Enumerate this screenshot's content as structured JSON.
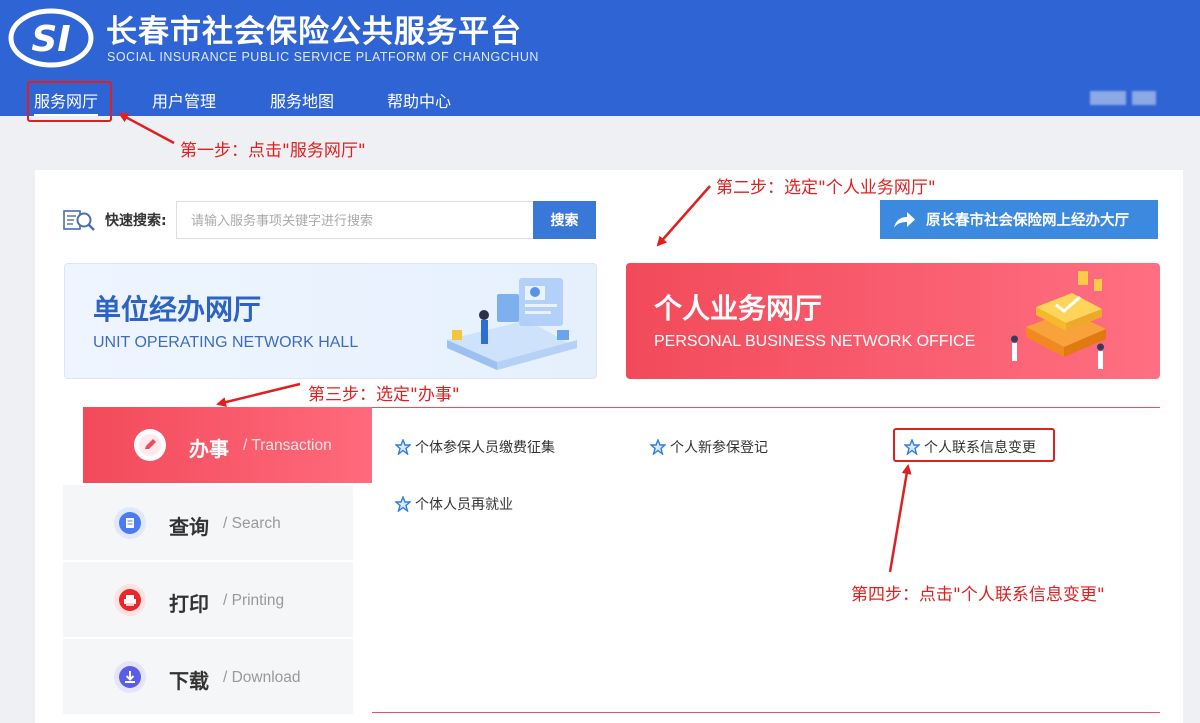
{
  "header": {
    "logo_text": "SI",
    "title": "长春市社会保险公共服务平台",
    "subtitle": "SOCIAL INSURANCE PUBLIC SERVICE PLATFORM OF CHANGCHUN"
  },
  "nav": {
    "items": [
      {
        "label": "服务网厅"
      },
      {
        "label": "用户管理"
      },
      {
        "label": "服务地图"
      },
      {
        "label": "帮助中心"
      }
    ]
  },
  "search": {
    "label": "快速搜索:",
    "placeholder": "请输入服务事项关键字进行搜索",
    "button": "搜索"
  },
  "old_hall_button": "原长春市社会保险网上经办大厅",
  "cards": {
    "unit": {
      "title": "单位经办网厅",
      "subtitle": "UNIT OPERATING NETWORK HALL"
    },
    "personal": {
      "title": "个人业务网厅",
      "subtitle": "PERSONAL BUSINESS NETWORK OFFICE"
    }
  },
  "categories": [
    {
      "label": "办事",
      "en": "/ Transaction"
    },
    {
      "label": "查询",
      "en": "/ Search"
    },
    {
      "label": "打印",
      "en": "/ Printing"
    },
    {
      "label": "下载",
      "en": "/ Download"
    }
  ],
  "services": [
    {
      "label": "个体参保人员缴费征集"
    },
    {
      "label": "个人新参保登记"
    },
    {
      "label": "个人联系信息变更"
    },
    {
      "label": "个体人员再就业"
    }
  ],
  "annotations": {
    "step1": "第一步：点击\"服务网厅\"",
    "step2": "第二步：选定\"个人业务网厅\"",
    "step3": "第三步：选定\"办事\"",
    "step4": "第四步：点击\"个人联系信息变更\""
  },
  "colors": {
    "header": "#2f64d4",
    "accent_red": "#f24a5a",
    "annotation_red": "#e02020",
    "button_blue": "#3a78d8"
  }
}
